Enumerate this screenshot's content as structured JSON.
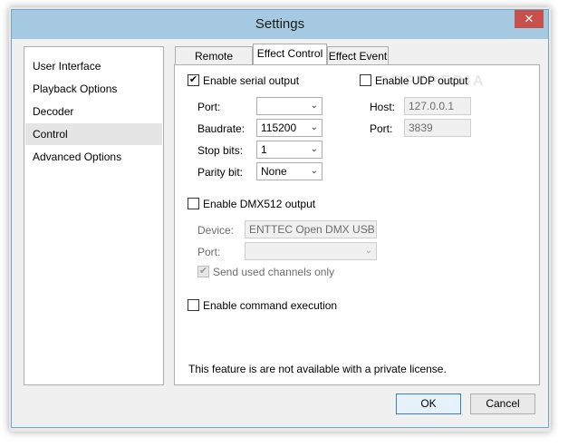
{
  "window": {
    "title": "Settings",
    "close_glyph": "✕"
  },
  "sidebar": {
    "items": [
      {
        "label": "User Interface"
      },
      {
        "label": "Playback Options"
      },
      {
        "label": "Decoder"
      },
      {
        "label": "Control",
        "selected": true
      },
      {
        "label": "Advanced Options"
      }
    ]
  },
  "tabs": [
    {
      "label": "Remote Control"
    },
    {
      "label": "Effect Control",
      "active": true
    },
    {
      "label": "Effect Event"
    }
  ],
  "serial": {
    "enable_label": "Enable serial output",
    "enabled": true,
    "port_label": "Port:",
    "port_value": "",
    "baudrate_label": "Baudrate:",
    "baudrate_value": "115200",
    "stopbits_label": "Stop bits:",
    "stopbits_value": "1",
    "parity_label": "Parity bit:",
    "parity_value": "None"
  },
  "udp": {
    "enable_label": "Enable UDP output",
    "enabled": false,
    "host_label": "Host:",
    "host_value": "127.0.0.1",
    "port_label": "Port:",
    "port_value": "3839"
  },
  "dmx": {
    "enable_label": "Enable DMX512 output",
    "enabled": false,
    "device_label": "Device:",
    "device_value": "ENTTEC Open DMX USB",
    "port_label": "Port:",
    "port_value": "",
    "send_used_label": "Send used channels only",
    "send_used_checked": true
  },
  "command": {
    "enable_label": "Enable command execution",
    "enabled": false
  },
  "notice": "This feature is are not available with a private license.",
  "buttons": {
    "ok": "OK",
    "cancel": "Cancel"
  },
  "glyphs": {
    "check": "✔",
    "dropdown": "⌄"
  },
  "watermark": "SOFTPEDIA"
}
